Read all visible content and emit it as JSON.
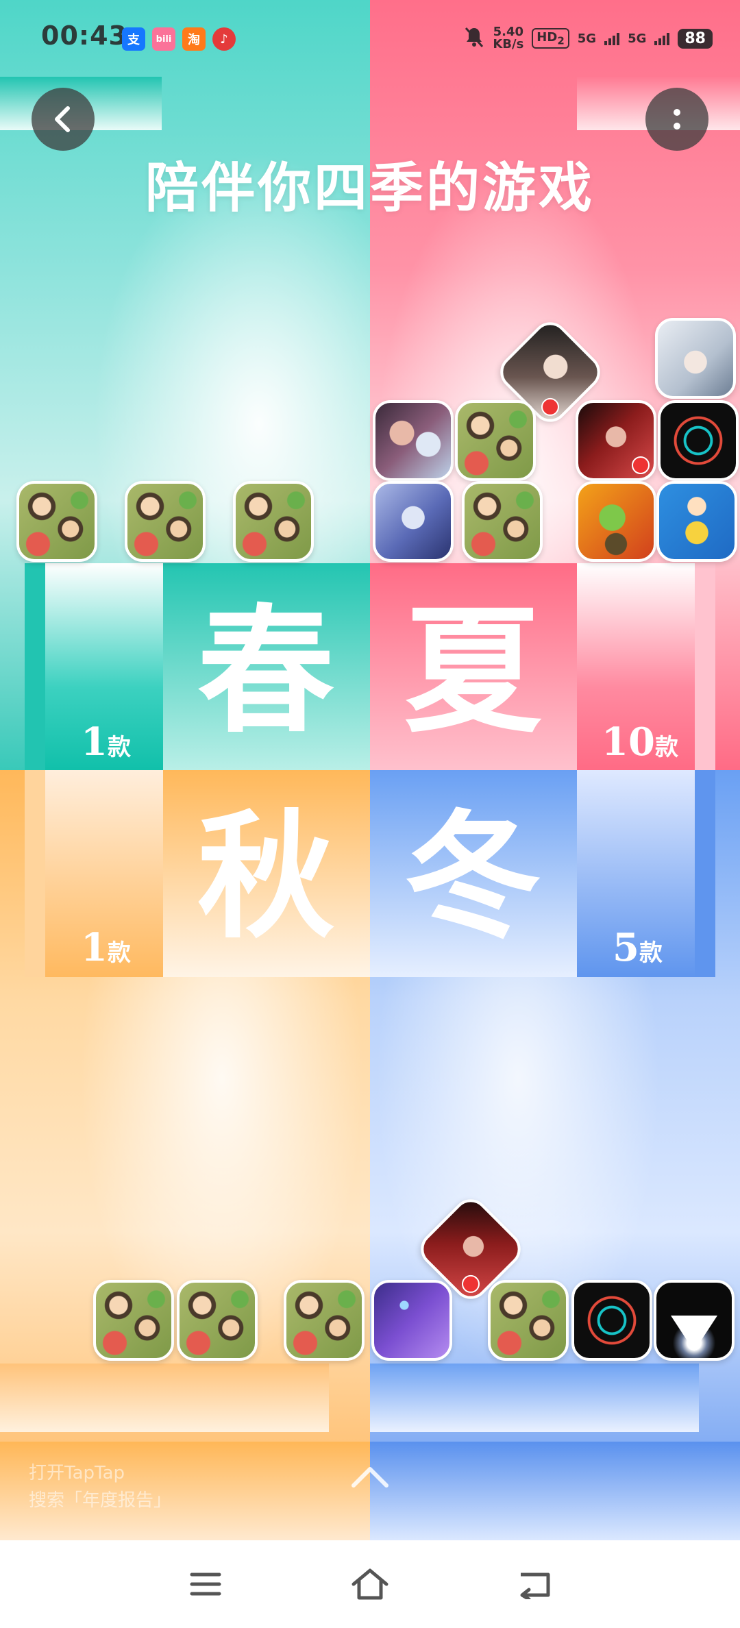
{
  "status_bar": {
    "time": "00:43",
    "notification_apps": [
      "alipay-icon",
      "bilibili-icon",
      "taobao-icon",
      "netease-music-icon"
    ],
    "app_badge_text": {
      "alipay": "支",
      "bilibili": "bili",
      "taobao": "淘",
      "netease": "♪"
    },
    "mute": "bell-off-icon",
    "net_speed_value": "5.40",
    "net_speed_unit": "KB/s",
    "hd_label": "HD",
    "hd_sub": "2",
    "network_1": "5G",
    "network_2": "5G",
    "battery": "88"
  },
  "header": {
    "title": "陪伴你四季的游戏",
    "back_icon": "chevron-left-icon",
    "more_icon": "more-vertical-icon"
  },
  "seasons": {
    "spring": {
      "name": "春",
      "count": "1",
      "unit": "款",
      "color": "#3cc9b8"
    },
    "summer": {
      "name": "夏",
      "count": "10",
      "unit": "款",
      "color": "#ff6f8a"
    },
    "autumn": {
      "name": "秋",
      "count": "1",
      "unit": "款",
      "color": "#ffb85a"
    },
    "winter": {
      "name": "冬",
      "count": "5",
      "unit": "款",
      "color": "#6aa0f3"
    }
  },
  "footer_hint": {
    "line1": "打开TapTap",
    "line2": "搜索「年度报告」"
  },
  "nav_bar": {
    "menu_icon": "menu-icon",
    "home_icon": "home-icon",
    "back_icon": "back-icon"
  }
}
